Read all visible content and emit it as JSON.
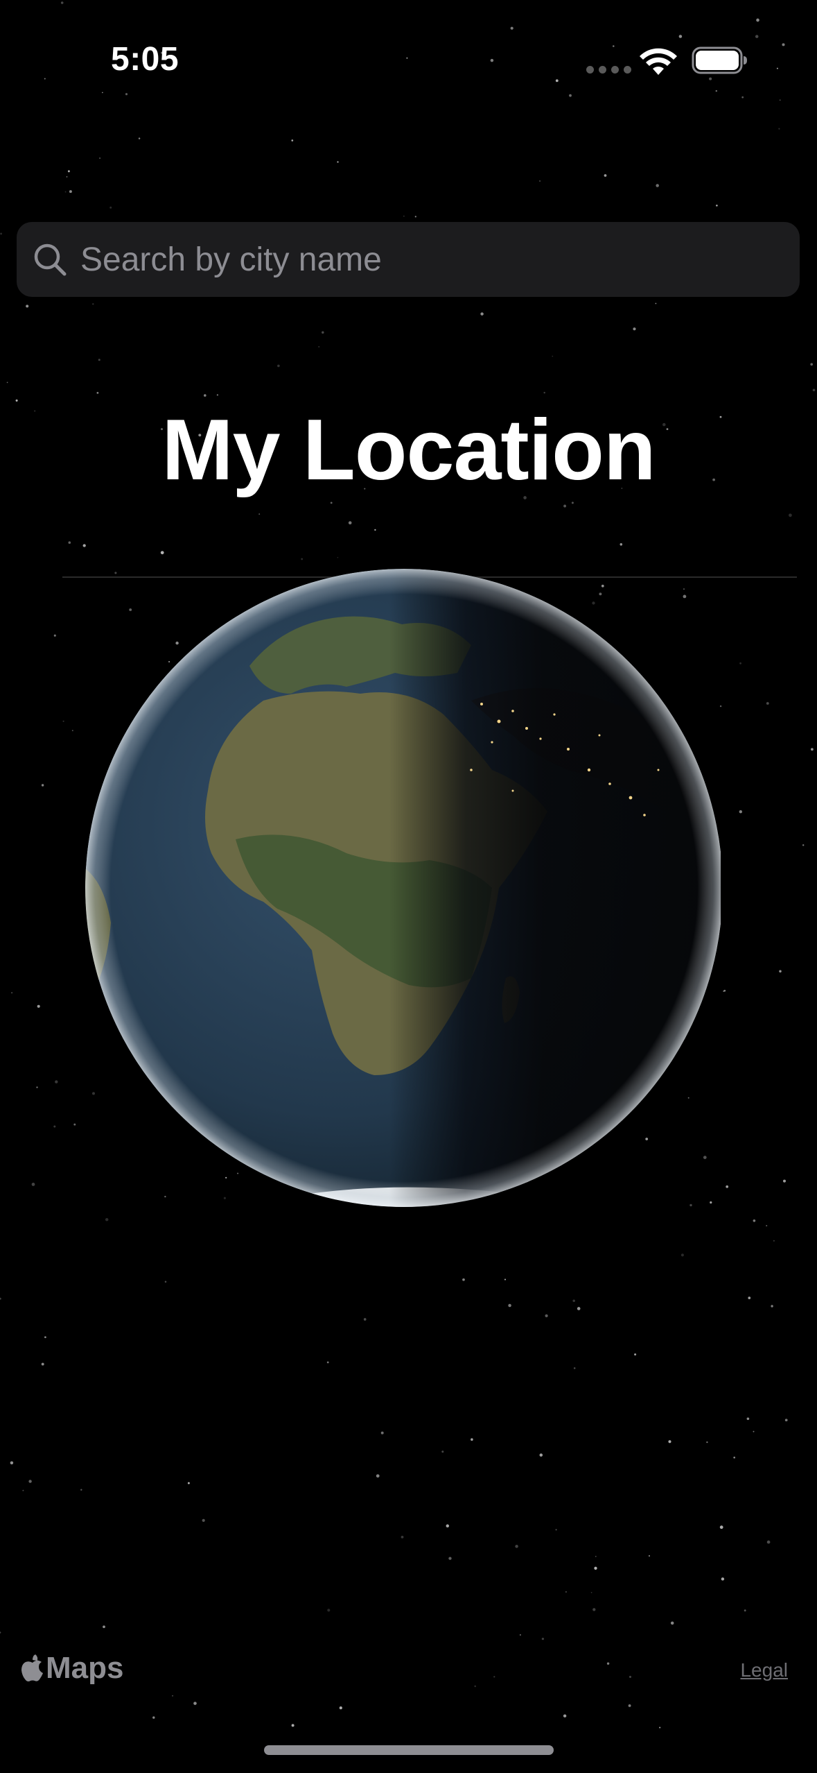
{
  "status_bar": {
    "time": "5:05"
  },
  "search": {
    "placeholder": "Search by city name",
    "value": ""
  },
  "main": {
    "title": "My Location"
  },
  "footer": {
    "maps_label": "Maps",
    "legal_label": "Legal"
  },
  "icons": {
    "search": "search-icon",
    "wifi": "wifi-icon",
    "battery": "battery-icon",
    "apple": "apple-logo-icon"
  },
  "colors": {
    "background": "#000000",
    "search_field": "#1c1c1e",
    "placeholder": "#8d8d93",
    "title": "#ffffff"
  }
}
